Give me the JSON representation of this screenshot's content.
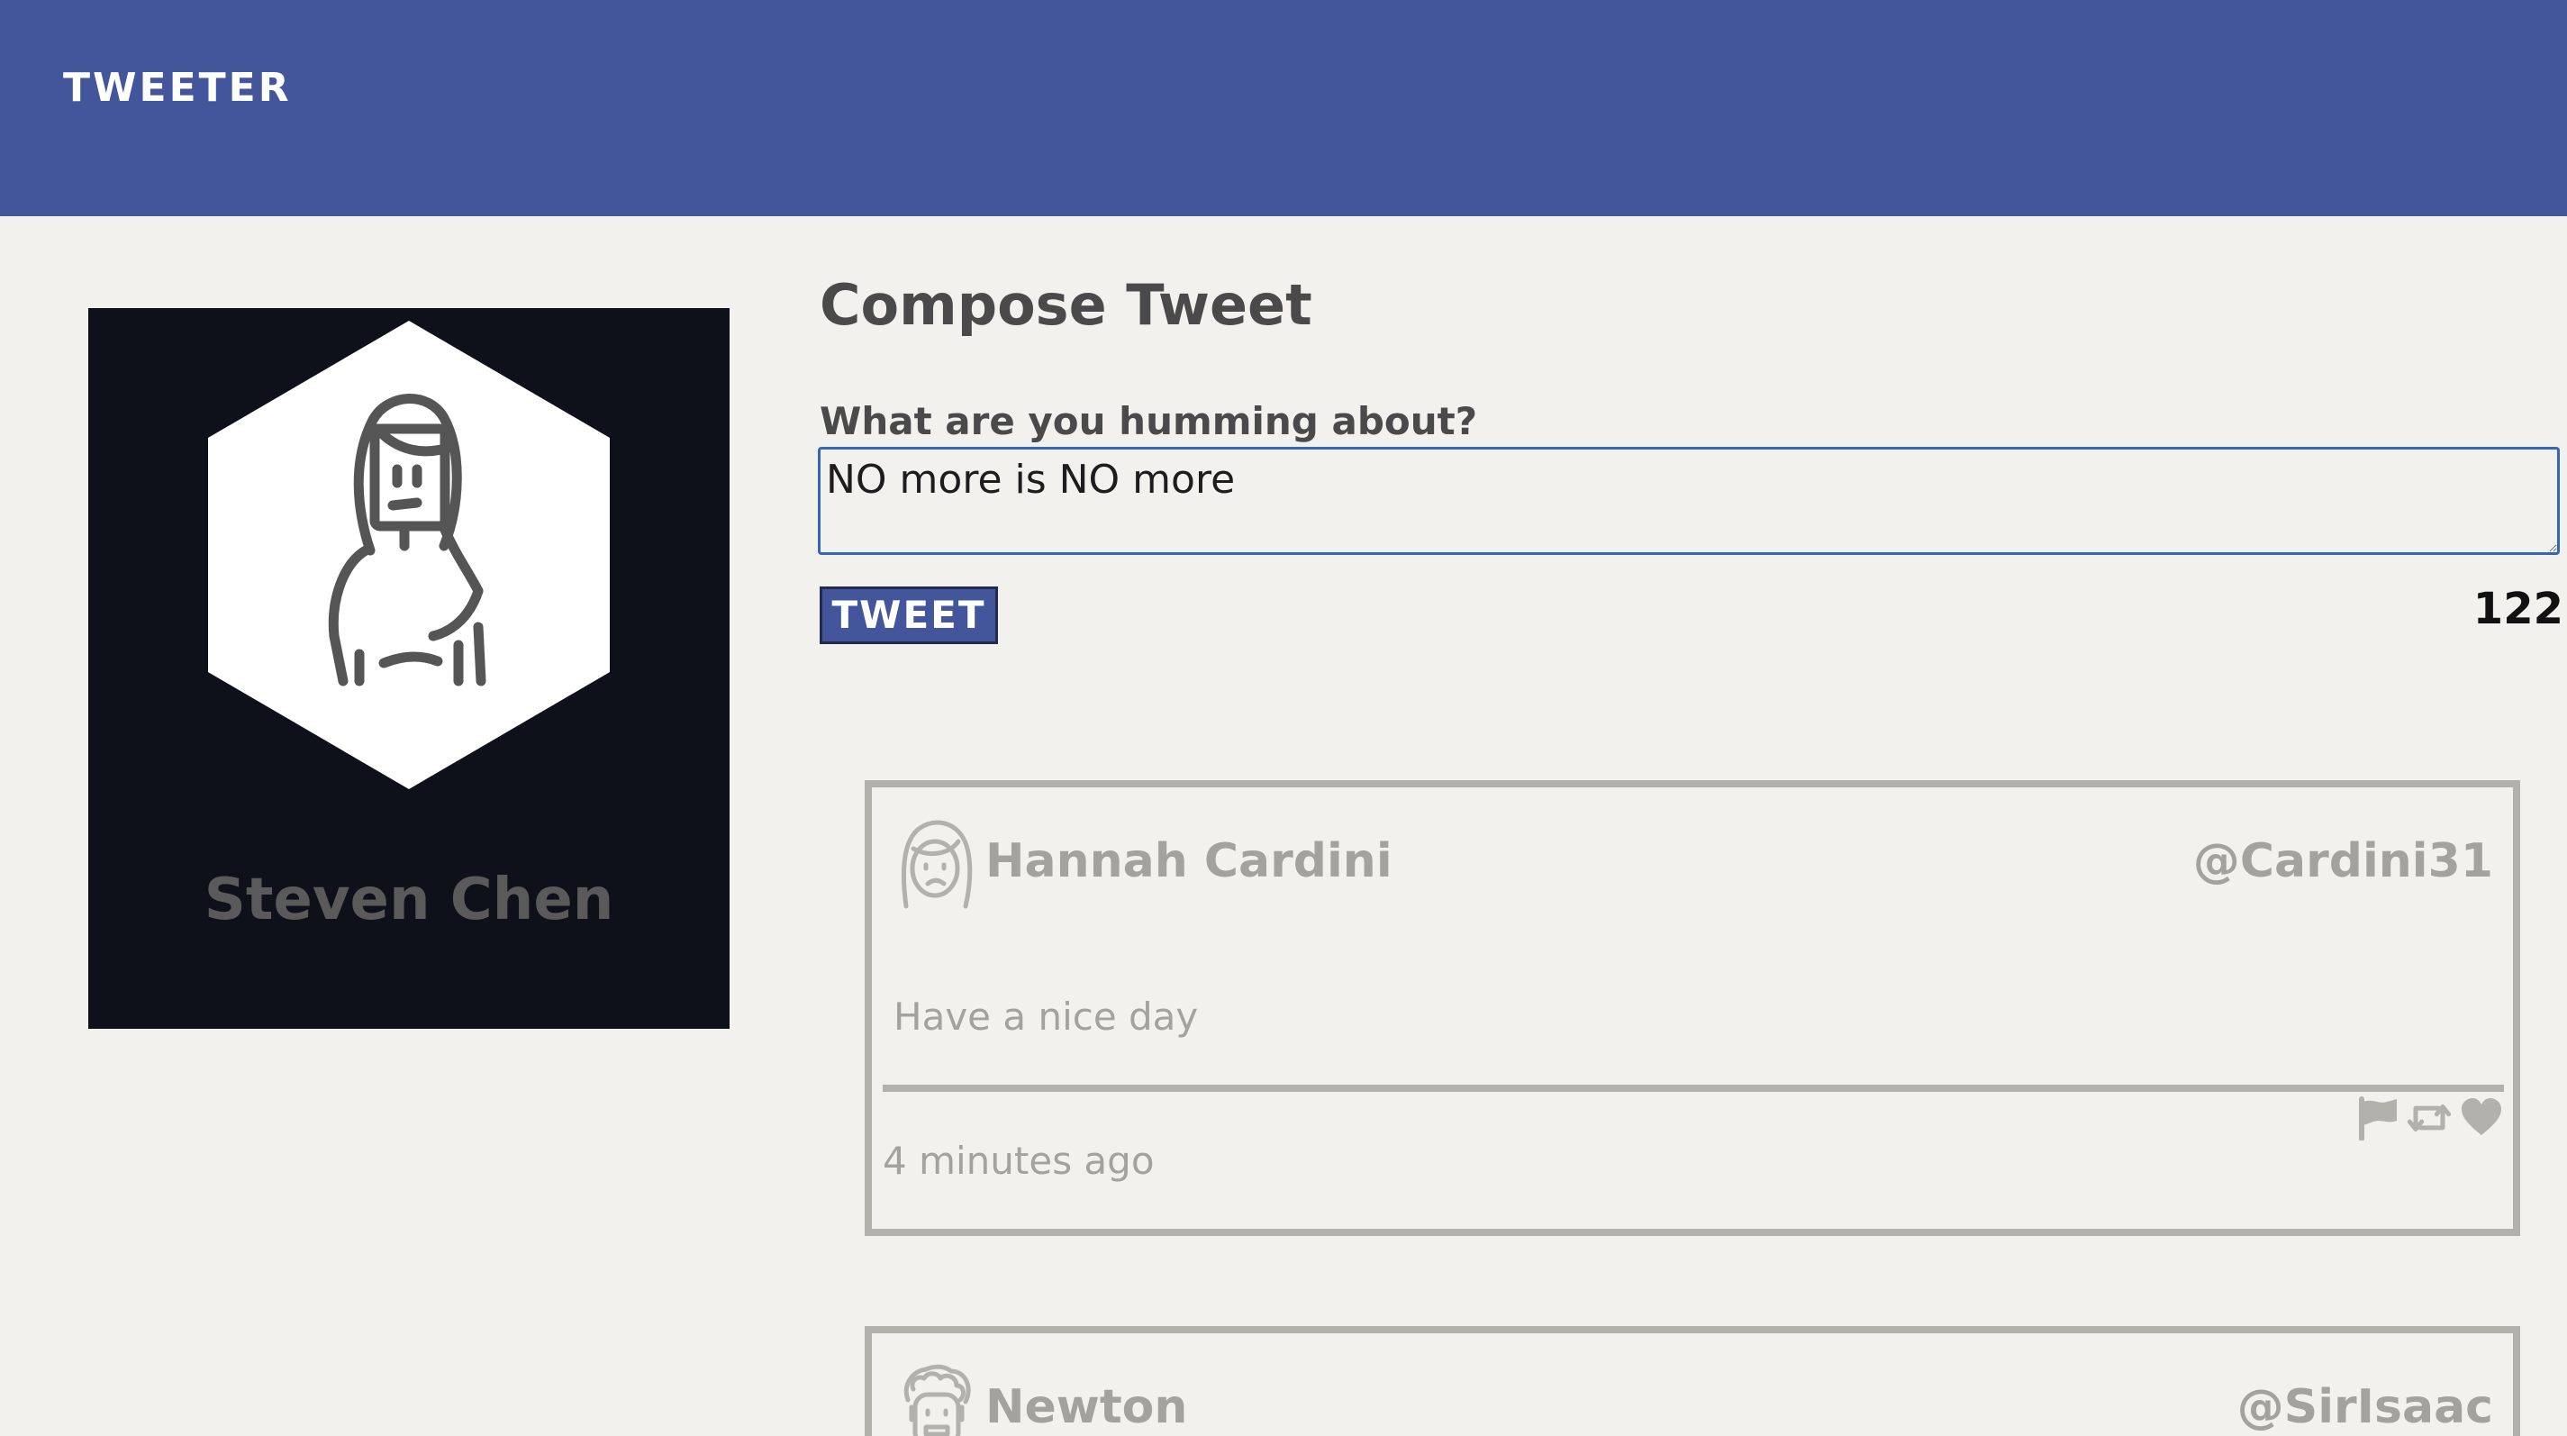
{
  "header": {
    "brand": "TWEETER",
    "background_color": "#43569b"
  },
  "profile": {
    "name": "Steven Chen",
    "avatar_icon": "user-avatar-icon"
  },
  "compose": {
    "title": "Compose Tweet",
    "label": "What are you humming about?",
    "text_value": "NO more is NO more",
    "button_label": "TWEET",
    "char_counter": "122"
  },
  "tweets": [
    {
      "author": "Hannah Cardini",
      "handle": "@Cardini31",
      "body": "Have a nice day",
      "time": "4 minutes ago",
      "avatar_icon": "user-avatar-icon",
      "actions": [
        "flag-icon",
        "retweet-icon",
        "heart-icon"
      ]
    },
    {
      "author": "Newton",
      "handle": "@SirIsaac",
      "avatar_icon": "user-avatar-icon"
    }
  ],
  "colors": {
    "page_background": "#f2f1ed",
    "profile_background": "#0e111a",
    "muted_text": "#a4a29d",
    "card_border": "#b3b1ab",
    "focus_border": "#3565b8"
  }
}
